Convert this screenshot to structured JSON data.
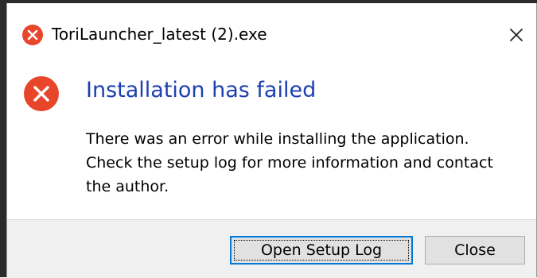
{
  "window": {
    "title": "ToriLauncher_latest (2).exe",
    "title_icon": "error-icon",
    "close_icon": "close-icon"
  },
  "dialog": {
    "heading": "Installation has failed",
    "heading_color": "#1c3fb2",
    "icon": "error-icon",
    "error_color": "#e8462b",
    "message_lines": [
      "There was an error while installing the application.",
      "Check the setup log for more information and contact",
      "the author."
    ]
  },
  "buttons": {
    "open_log": "Open Setup Log",
    "close": "Close"
  }
}
